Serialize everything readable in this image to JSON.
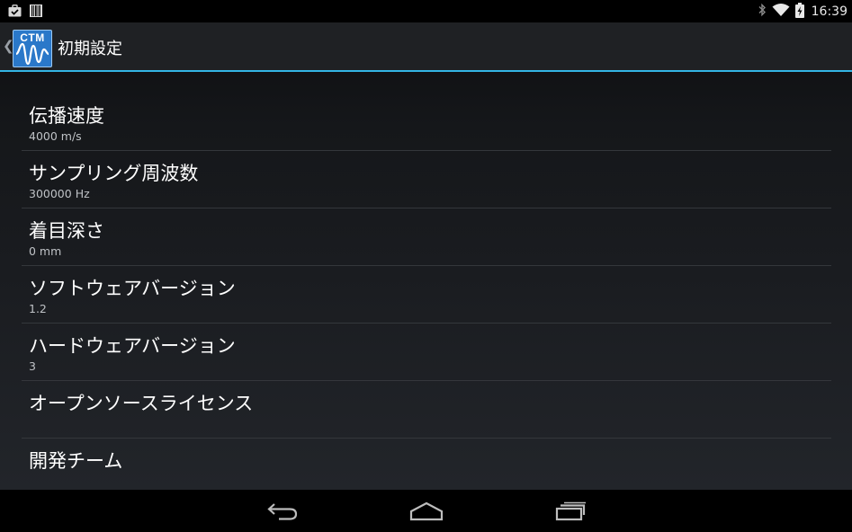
{
  "status_bar": {
    "time": "16:39",
    "icons_left": [
      "briefcase-check-icon",
      "barcode-icon"
    ],
    "icons_right": [
      "bluetooth-icon",
      "wifi-icon",
      "battery-charging-icon"
    ]
  },
  "action_bar": {
    "logo_text": "CTM",
    "title": "初期設定",
    "accent_color": "#33b5e5",
    "logo_color": "#2a78c9"
  },
  "preferences": [
    {
      "title": "伝播速度",
      "summary": "4000 m/s"
    },
    {
      "title": "サンプリング周波数",
      "summary": "300000 Hz"
    },
    {
      "title": "着目深さ",
      "summary": "0 mm"
    },
    {
      "title": "ソフトウェアバージョン",
      "summary": "1.2"
    },
    {
      "title": "ハードウェアバージョン",
      "summary": "3"
    },
    {
      "title": "オープンソースライセンス",
      "summary": ""
    },
    {
      "title": "開発チーム",
      "summary": ""
    }
  ],
  "nav_bar": {
    "icons": [
      "back-icon",
      "home-icon",
      "recent-apps-icon"
    ]
  }
}
